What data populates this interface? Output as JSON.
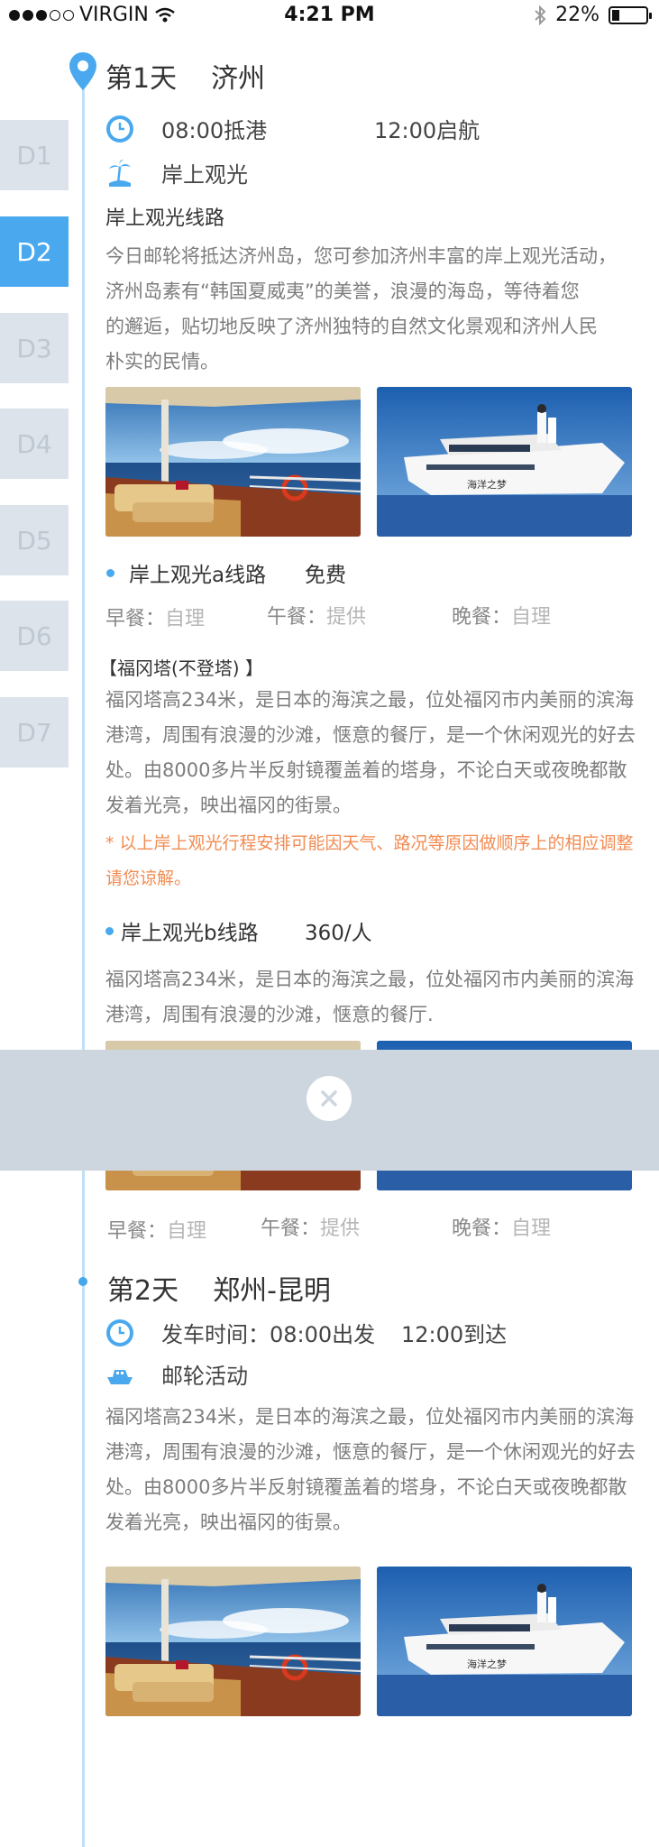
{
  "status_bar": {
    "carrier": "VIRGIN",
    "time": "4:21 PM",
    "battery": "22%",
    "battery_level": 0.22
  },
  "day_tabs": [
    "D1",
    "D2",
    "D3",
    "D4",
    "D5",
    "D6",
    "D7"
  ],
  "active_tab": "D2",
  "day1": {
    "day_label": "第1天",
    "place": "济州",
    "arrive": "08:00抵港",
    "depart": "12:00启航",
    "activity": "岸上观光",
    "route_title": "岸上观光线路",
    "intro_lines": [
      "今日邮轮将抵达济州岛，您可参加济州丰富的岸上观光活动，",
      "济州岛素有“韩国夏威夷”的美誉，浪漫的海岛，等待着您",
      "的邂逅，贴切地反映了济州独特的自然文化景观和济州人民",
      "朴实的民情。"
    ],
    "route_a": {
      "name": "岸上观光a线路",
      "price": "免费"
    },
    "meals": {
      "breakfast_label": "早餐：",
      "breakfast": "自理",
      "lunch_label": "午餐：",
      "lunch": "提供",
      "dinner_label": "晚餐：",
      "dinner": "自理"
    },
    "attraction_title": "【福冈塔(不登塔) 】",
    "attraction_lines": [
      "福冈塔高234米，是日本的海滨之最，位处福冈市内美丽的滨海",
      "港湾，周围有浪漫的沙滩，惬意的餐厅，是一个休闲观光的好去",
      "处。由8000多片半反射镜覆盖着的塔身，不论白天或夜晚都散",
      "发着光亮，映出福冈的街景。"
    ],
    "note_lines": [
      "* 以上岸上观光行程安排可能因天气、路况等原因做顺序上的相应调整",
      "请您谅解。"
    ],
    "route_b": {
      "name": "岸上观光b线路",
      "price": "360/人"
    },
    "route_b_lines": [
      "福冈塔高234米，是日本的海滨之最，位处福冈市内美丽的滨海",
      "港湾，周围有浪漫的沙滩，惬意的餐厅."
    ],
    "meals_b": {
      "breakfast_label": "早餐：",
      "breakfast": "自理",
      "lunch_label": "午餐：",
      "lunch": "提供",
      "dinner_label": "晚餐：",
      "dinner": "自理"
    },
    "photo_caption": "海洋之梦"
  },
  "day2": {
    "day_label": "第2天",
    "place": "郑州-昆明",
    "depart": "发车时间：08:00出发",
    "arrive": "12:00到达",
    "activity": "邮轮活动",
    "desc_lines": [
      "福冈塔高234米，是日本的海滨之最，位处福冈市内美丽的滨海",
      "港湾，周围有浪漫的沙滩，惬意的餐厅，是一个休闲观光的好去",
      "处。由8000多片半反射镜覆盖着的塔身，不论白天或夜晚都散",
      "发着光亮，映出福冈的街景。"
    ]
  },
  "colors": {
    "accent": "#4aa9ee",
    "note": "#f28c52",
    "overlay": "#cdd6de"
  },
  "icons": [
    "location-pin-icon",
    "clock-icon",
    "beach-icon",
    "ship-icon",
    "close-icon",
    "wifi-icon",
    "bluetooth-icon"
  ]
}
